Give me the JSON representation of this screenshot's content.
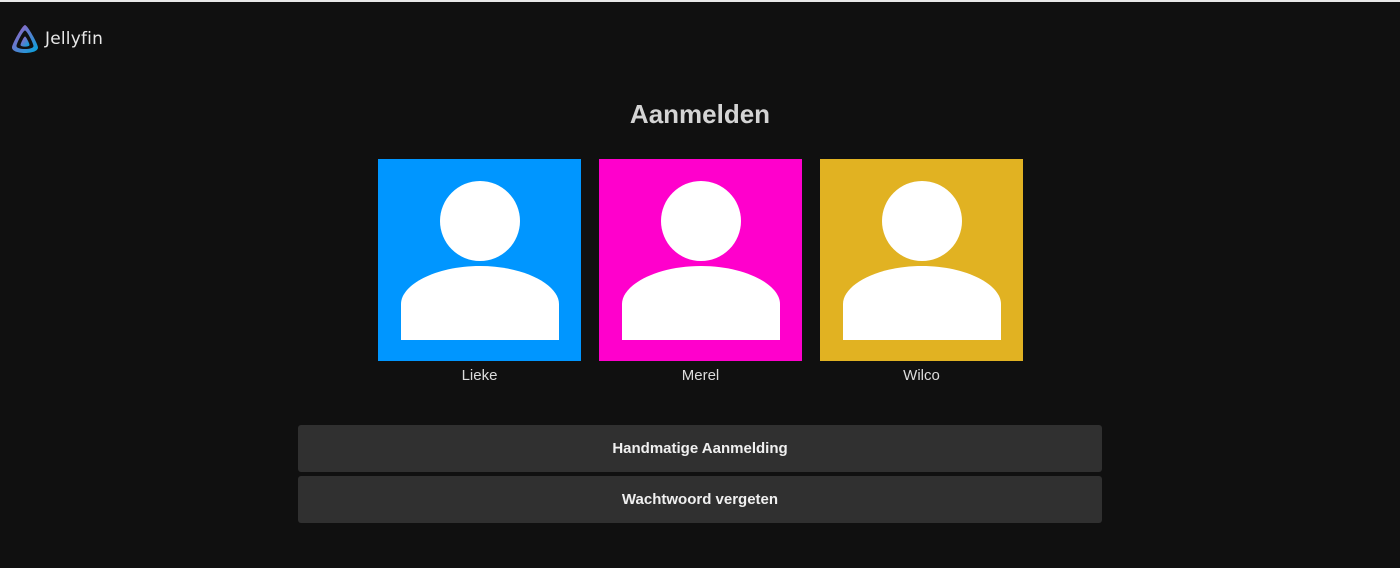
{
  "app": {
    "name": "Jellyfin"
  },
  "page": {
    "title": "Aanmelden"
  },
  "users": [
    {
      "name": "Lieke",
      "color": "#0096ff",
      "icon": "user-silhouette-icon"
    },
    {
      "name": "Merel",
      "color": "#ff00cc",
      "icon": "user-silhouette-icon"
    },
    {
      "name": "Wilco",
      "color": "#e1b222",
      "icon": "user-silhouette-icon"
    }
  ],
  "buttons": {
    "manual_login": "Handmatige Aanmelding",
    "forgot_password": "Wachtwoord vergeten"
  }
}
